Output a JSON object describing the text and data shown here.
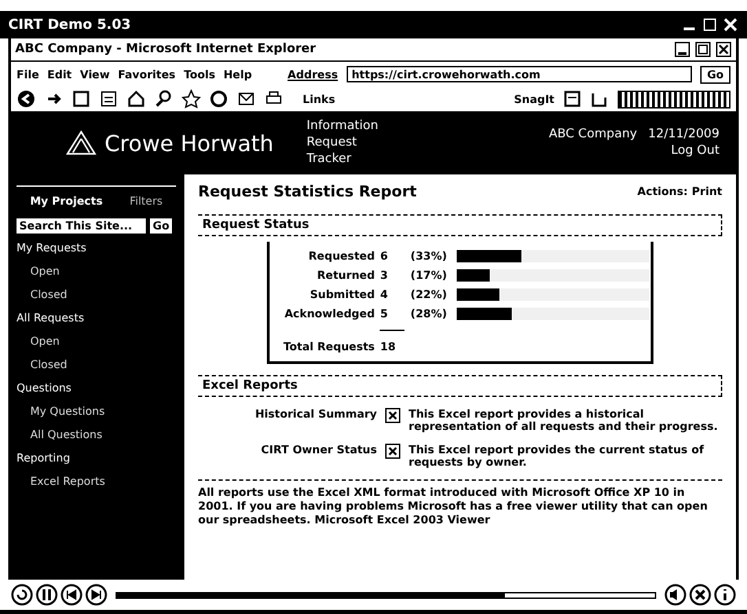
{
  "player": {
    "title": "CIRT Demo 5.03",
    "progress": {
      "level": 0.72
    }
  },
  "browser": {
    "title": "ABC Company - Microsoft Internet Explorer",
    "menu": [
      "File",
      "Edit",
      "View",
      "Favorites",
      "Tools",
      "Help"
    ],
    "address_label": "Address",
    "url": "https://cirt.crowehorwath.com",
    "go": "Go",
    "links": "Links",
    "snagit": "SnagIt"
  },
  "header": {
    "logo": "Crowe Horwath",
    "app_name": "Information Request Tracker",
    "company": "ABC Company",
    "date": "12/11/2009",
    "logout": "Log Out"
  },
  "sidebar": {
    "tabs": [
      {
        "label": "My Projects",
        "selected": true
      },
      {
        "label": "Filters",
        "selected": false
      }
    ],
    "search": {
      "placeholder": "Search This Site...",
      "button": "Go"
    },
    "sections": [
      {
        "label": "My Requests",
        "children": [
          {
            "label": "Open"
          },
          {
            "label": "Closed"
          }
        ]
      },
      {
        "label": "All Requests",
        "children": [
          {
            "label": "Open"
          },
          {
            "label": "Closed"
          }
        ]
      },
      {
        "label": "Questions",
        "children": [
          {
            "label": "My Questions"
          },
          {
            "label": "All Questions"
          }
        ]
      },
      {
        "label": "Reporting",
        "children": [
          {
            "label": "Excel Reports"
          }
        ]
      }
    ]
  },
  "report": {
    "title": "Request Statistics Report",
    "actions_label": "Actions:",
    "actions": [
      "Print"
    ],
    "status_heading": "Request Status",
    "stats": [
      {
        "label": "Requested",
        "count": "6",
        "percent": "(33%)",
        "level": 0.33
      },
      {
        "label": "Returned",
        "count": "3",
        "percent": "(17%)",
        "level": 0.17
      },
      {
        "label": "Submitted",
        "count": "4",
        "percent": "(22%)",
        "level": 0.22
      },
      {
        "label": "Acknowledged",
        "count": "5",
        "percent": "(28%)",
        "level": 0.28
      }
    ],
    "total_label": "Total Requests",
    "total": "18",
    "excel_heading": "Excel Reports",
    "excel": [
      {
        "name": "Historical Summary",
        "description": "This Excel report provides a historical representation of all requests and their progress."
      },
      {
        "name": "CIRT Owner Status",
        "description": "This Excel report provides the current status of requests by owner."
      }
    ],
    "note": "All reports use the Excel XML format introduced with Microsoft Office XP 10 in 2001. If you are having problems Microsoft has a free viewer utility that can open our spreadsheets.",
    "note_link": "Microsoft Excel 2003 Viewer"
  }
}
